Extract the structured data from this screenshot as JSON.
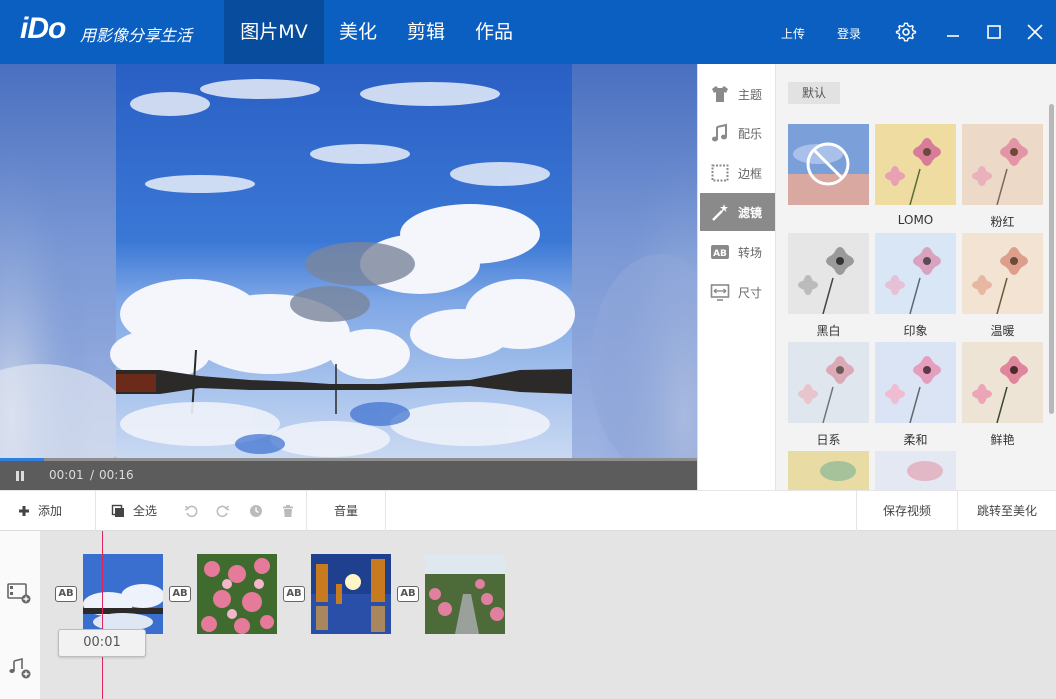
{
  "app": {
    "logo": "iDo",
    "slogan": "用影像分享生活",
    "brand_color": "#0a5fc0"
  },
  "nav": {
    "tabs": [
      {
        "label": "图片MV",
        "active": true
      },
      {
        "label": "美化"
      },
      {
        "label": "剪辑"
      },
      {
        "label": "作品"
      }
    ]
  },
  "header": {
    "upload_label": "上传",
    "login_label": "登录",
    "icons": [
      "gear-icon",
      "minimize-icon",
      "maximize-icon",
      "close-icon"
    ]
  },
  "player": {
    "current_time": "00:01",
    "separator": "/",
    "total_time": "00:16",
    "progress": 0.0625,
    "state": "pause-icon"
  },
  "side_menu": {
    "items": [
      {
        "label": "主题",
        "icon": "tshirt-icon"
      },
      {
        "label": "配乐",
        "icon": "music-note-icon"
      },
      {
        "label": "边框",
        "icon": "frame-icon"
      },
      {
        "label": "滤镜",
        "icon": "magic-wand-icon",
        "active": true
      },
      {
        "label": "转场",
        "icon": "transition-ab-icon"
      },
      {
        "label": "尺寸",
        "icon": "resize-icon"
      }
    ]
  },
  "filters": {
    "category": "默认",
    "items": [
      {
        "label": "",
        "name": "none"
      },
      {
        "label": "LOMO"
      },
      {
        "label": "粉红"
      },
      {
        "label": "黑白"
      },
      {
        "label": "印象"
      },
      {
        "label": "温暖"
      },
      {
        "label": "日系"
      },
      {
        "label": "柔和"
      },
      {
        "label": "鲜艳"
      },
      {
        "label": ""
      },
      {
        "label": ""
      }
    ]
  },
  "toolbar": {
    "add_label": "添加",
    "select_all_label": "全选",
    "volume_label": "音量",
    "save_video_label": "保存视频",
    "goto_beautify_label": "跳转至美化"
  },
  "timeline": {
    "playhead_time": "00:01",
    "clips": [
      "sky-clouds",
      "pink-flowers",
      "night-trees",
      "garden-path"
    ],
    "transition_label": "AB"
  }
}
